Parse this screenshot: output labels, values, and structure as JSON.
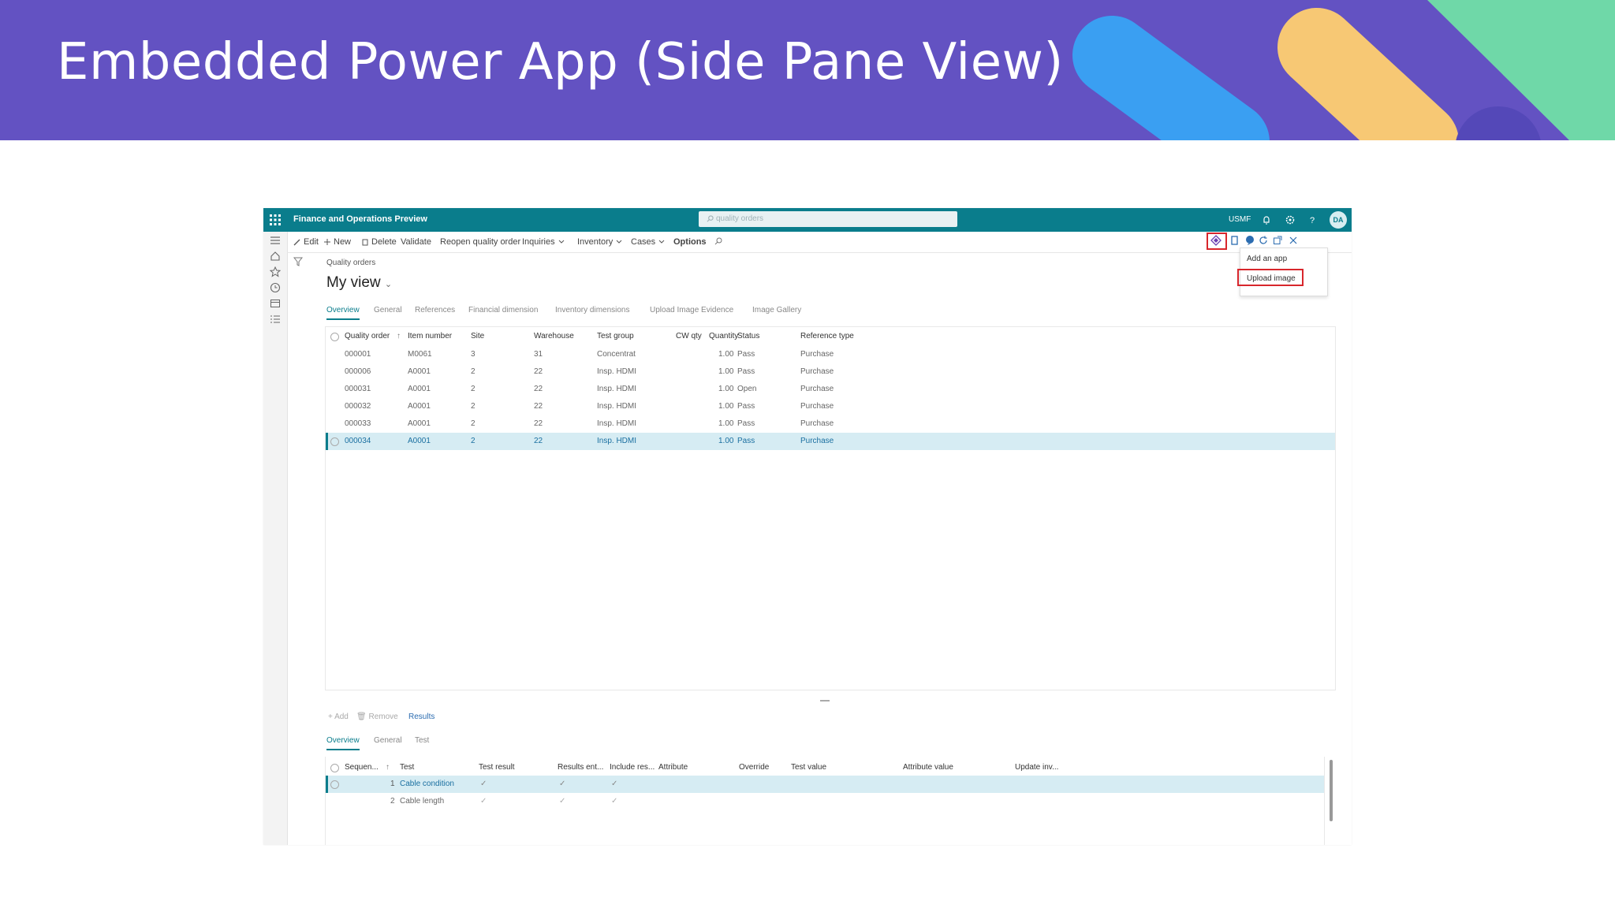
{
  "slide": {
    "title": "Embedded Power App (Side Pane View)"
  },
  "app": {
    "name": "Finance and Operations Preview",
    "search_placeholder": "quality orders",
    "company": "USMF",
    "avatar": "DA"
  },
  "actions": [
    "Edit",
    "New",
    "Delete",
    "Validate",
    "Reopen quality order",
    "Inquiries",
    "Inventory",
    "Cases",
    "Options"
  ],
  "power_apps_menu": [
    "Add an app",
    "Upload image"
  ],
  "page": {
    "breadcrumb": "Quality orders",
    "view": "My view",
    "tabs": [
      "Overview",
      "General",
      "References",
      "Financial dimension",
      "Inventory dimensions",
      "Upload Image Evidence",
      "Image Gallery"
    ]
  },
  "grid": {
    "headers": [
      "Quality order",
      "Item number",
      "Site",
      "Warehouse",
      "Test group",
      "CW qty",
      "Quantity",
      "Status",
      "Reference type"
    ],
    "rows": [
      [
        "000001",
        "M0061",
        "3",
        "31",
        "Concentrat",
        "",
        "1.00",
        "Pass",
        "Purchase"
      ],
      [
        "000006",
        "A0001",
        "2",
        "22",
        "Insp. HDMI",
        "",
        "1.00",
        "Pass",
        "Purchase"
      ],
      [
        "000031",
        "A0001",
        "2",
        "22",
        "Insp. HDMI",
        "",
        "1.00",
        "Open",
        "Purchase"
      ],
      [
        "000032",
        "A0001",
        "2",
        "22",
        "Insp. HDMI",
        "",
        "1.00",
        "Pass",
        "Purchase"
      ],
      [
        "000033",
        "A0001",
        "2",
        "22",
        "Insp. HDMI",
        "",
        "1.00",
        "Pass",
        "Purchase"
      ],
      [
        "000034",
        "A0001",
        "2",
        "22",
        "Insp. HDMI",
        "",
        "1.00",
        "Pass",
        "Purchase"
      ]
    ],
    "selected_index": 5
  },
  "lower": {
    "actions": [
      "Add",
      "Remove",
      "Results"
    ],
    "tabs": [
      "Overview",
      "General",
      "Test"
    ],
    "headers": [
      "Sequen...",
      "Test",
      "Test result",
      "Results ent...",
      "Include res...",
      "Attribute",
      "Override",
      "Test value",
      "Attribute value",
      "Update inv..."
    ],
    "rows": [
      {
        "seq": "1",
        "test": "Cable condition"
      },
      {
        "seq": "2",
        "test": "Cable length"
      }
    ]
  },
  "colors": {
    "banner": "#6352c2",
    "nav": "#0a7d8c",
    "highlight": "#d8262c",
    "selected_row": "#d6ecf3"
  }
}
